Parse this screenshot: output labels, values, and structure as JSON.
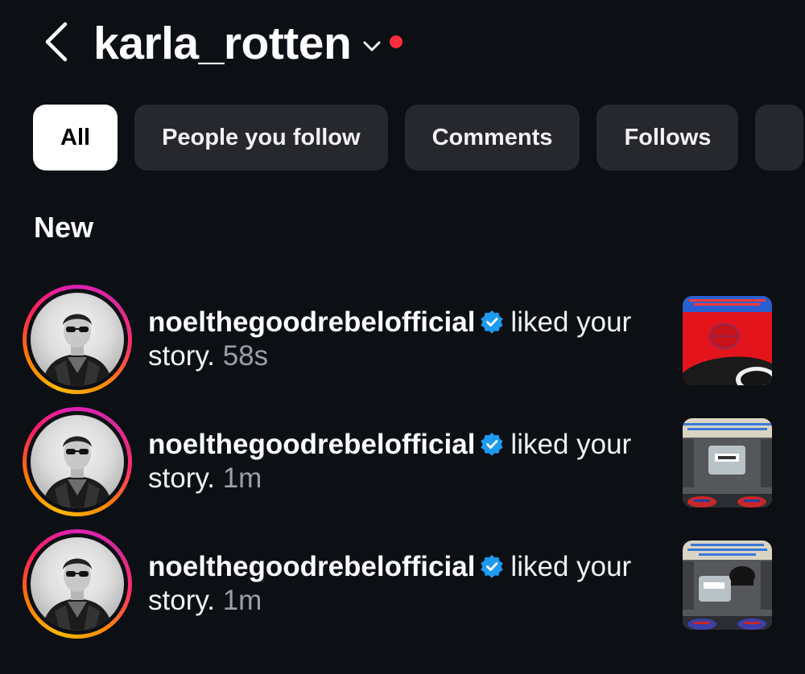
{
  "header": {
    "title": "karla_rotten"
  },
  "filters": {
    "items": [
      {
        "label": "All",
        "active": true
      },
      {
        "label": "People you follow",
        "active": false
      },
      {
        "label": "Comments",
        "active": false
      },
      {
        "label": "Follows",
        "active": false
      }
    ]
  },
  "section": {
    "title": "New"
  },
  "notifications": [
    {
      "username": "noelthegoodrebelofficial",
      "action": "liked your story.",
      "time": "58s"
    },
    {
      "username": "noelthegoodrebelofficial",
      "action": "liked your story.",
      "time": "1m"
    },
    {
      "username": "noelthegoodrebelofficial",
      "action": "liked your story.",
      "time": "1m"
    }
  ],
  "colors": {
    "background": "#0c0f14",
    "chip": "#26282e",
    "chip_active": "#ffffff",
    "verified": "#1d9bf0",
    "dot": "#ff2d3d",
    "muted": "#9aa0a6"
  },
  "icons": {
    "back": "chevron-left-icon",
    "title_menu": "chevron-down-icon",
    "verified": "verified-badge-icon"
  }
}
